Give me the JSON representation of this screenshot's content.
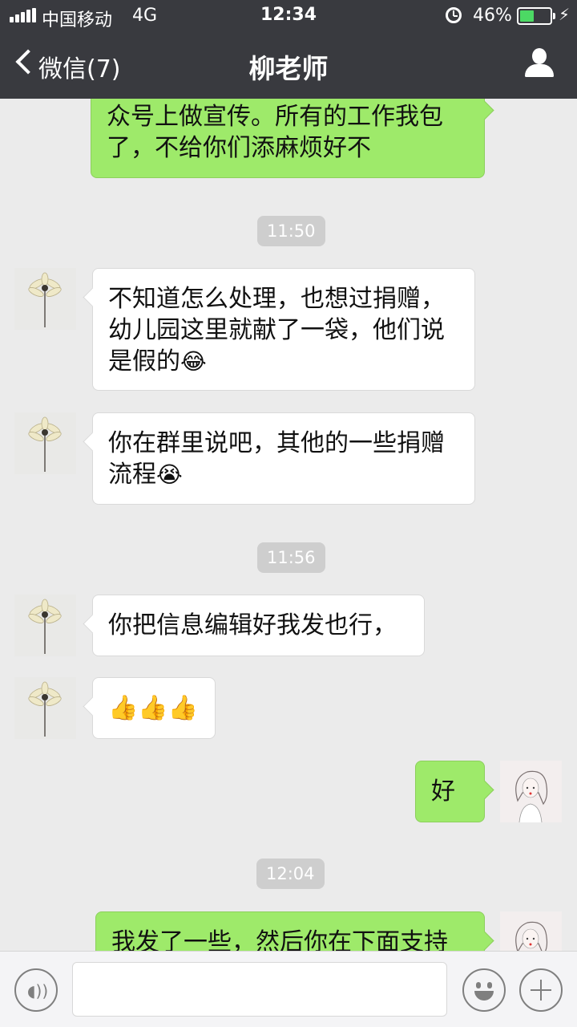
{
  "status_bar": {
    "carrier": "中国移动",
    "network": "4G",
    "time": "12:34",
    "battery": "46%",
    "battery_level": 0.46,
    "icons": [
      "signal-icon",
      "alarm-icon",
      "battery-icon",
      "charging-icon"
    ]
  },
  "nav": {
    "back_label": "微信(7)",
    "title": "柳老师",
    "right_icon": "profile-icon"
  },
  "messages": [
    {
      "side": "out",
      "text": "众号上做宣传。所有的工作我包\n了，不给你们添麻烦好不"
    },
    {
      "time": "11:50"
    },
    {
      "side": "in",
      "text": "不知道怎么处理，也想过捐赠，\n幼儿园这里就献了一袋，他们说\n是假的",
      "emoji": "😂"
    },
    {
      "side": "in",
      "text": "你在群里说吧，其他的一些捐赠\n流程",
      "emoji": "😭"
    },
    {
      "time": "11:56"
    },
    {
      "side": "in",
      "text": "你把信息编辑好我发也行，"
    },
    {
      "side": "in",
      "text": "👍👍👍"
    },
    {
      "side": "out",
      "text": "好"
    },
    {
      "time": "12:04"
    },
    {
      "side": "out",
      "text": "我发了一些，然后你在下面支持"
    }
  ],
  "colors": {
    "nav_bg": "#393a3f",
    "chat_bg": "#ebebeb",
    "bubble_out": "#9eea6a",
    "bubble_in": "#ffffff",
    "battery_fill": "#4cd964"
  },
  "input_bar": {
    "icons": [
      "voice-icon",
      "emoji-icon",
      "plus-icon"
    ]
  }
}
